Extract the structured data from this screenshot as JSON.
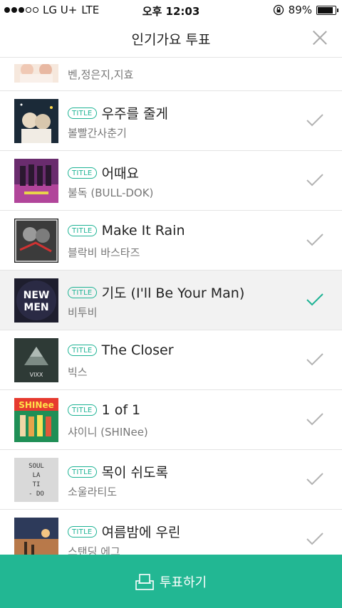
{
  "status": {
    "carrier": "LG U+",
    "network": "LTE",
    "time": "오후 12:03",
    "battery": "89%",
    "battery_level": 0.89
  },
  "header": {
    "title": "인기가요 투표"
  },
  "badge_label": "TITLE",
  "songs": [
    {
      "title": "",
      "artist": "벤,정은지,지효",
      "badge": false,
      "selected": false
    },
    {
      "title": "우주를 줄게",
      "artist": "볼빨간사춘기",
      "badge": true,
      "selected": false
    },
    {
      "title": "어때요",
      "artist": "불독 (BULL-DOK)",
      "badge": true,
      "selected": false
    },
    {
      "title": "Make It Rain",
      "artist": "블락비 바스타즈",
      "badge": true,
      "selected": false
    },
    {
      "title": "기도 (I'll Be Your Man)",
      "artist": "비투비",
      "badge": true,
      "selected": true
    },
    {
      "title": "The Closer",
      "artist": "빅스",
      "badge": true,
      "selected": false
    },
    {
      "title": "1 of 1",
      "artist": "샤이니 (SHINee)",
      "badge": true,
      "selected": false
    },
    {
      "title": "목이 쉬도록",
      "artist": "소울라티도",
      "badge": true,
      "selected": false
    },
    {
      "title": "여름밤에 우린",
      "artist": "스탠딩 에그",
      "badge": true,
      "selected": false
    }
  ],
  "album_text": {
    "vixx": "VIXX",
    "newmen": [
      "NEW",
      "MEN"
    ],
    "shinee": "SHINee",
    "soul": [
      "SOUL",
      "LA",
      "TI",
      "- DO"
    ]
  },
  "vote_button": {
    "label": "투표하기"
  },
  "colors": {
    "accent": "#1db394",
    "vote_bar": "#22b793",
    "check_inactive": "#b3b3b3"
  }
}
